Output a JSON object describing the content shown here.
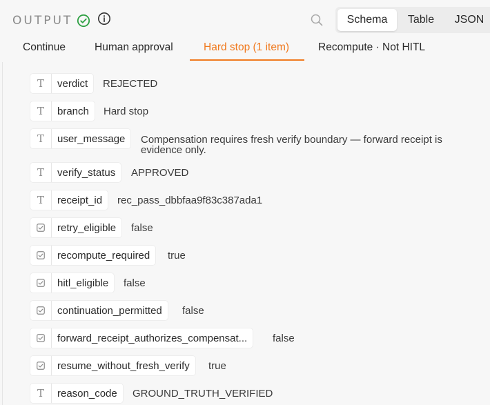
{
  "header": {
    "title": "OUTPUT",
    "status_icon": "check-circle-icon",
    "info_icon": "info-icon",
    "search_icon": "search-icon",
    "colors": {
      "status": "#2ea043",
      "accent": "#f07a1f"
    }
  },
  "view_tabs": [
    {
      "label": "Schema",
      "active": true
    },
    {
      "label": "Table",
      "active": false
    },
    {
      "label": "JSON",
      "active": false
    }
  ],
  "branch_tabs": [
    {
      "label": "Continue",
      "active": false
    },
    {
      "label": "Human approval",
      "active": false
    },
    {
      "label": "Hard stop (1 item)",
      "active": true
    },
    {
      "label": "Recompute · Not HITL",
      "active": false
    }
  ],
  "fields": [
    {
      "type": "string",
      "key": "verdict",
      "value": "REJECTED"
    },
    {
      "type": "string",
      "key": "branch",
      "value": "Hard stop"
    },
    {
      "type": "string",
      "key": "user_message",
      "value": "Compensation requires fresh verify boundary — forward receipt is evidence only."
    },
    {
      "type": "string",
      "key": "verify_status",
      "value": "APPROVED"
    },
    {
      "type": "string",
      "key": "receipt_id",
      "value": "rec_pass_dbbfaa9f83c387ada1"
    },
    {
      "type": "boolean",
      "key": "retry_eligible",
      "value": "false"
    },
    {
      "type": "boolean",
      "key": "recompute_required",
      "value": "true"
    },
    {
      "type": "boolean",
      "key": "hitl_eligible",
      "value": "false"
    },
    {
      "type": "boolean",
      "key": "continuation_permitted",
      "value": "false"
    },
    {
      "type": "boolean",
      "key": "forward_receipt_authorizes_compensat...",
      "value": "false"
    },
    {
      "type": "boolean",
      "key": "resume_without_fresh_verify",
      "value": "true"
    },
    {
      "type": "string",
      "key": "reason_code",
      "value": "GROUND_TRUTH_VERIFIED"
    }
  ]
}
